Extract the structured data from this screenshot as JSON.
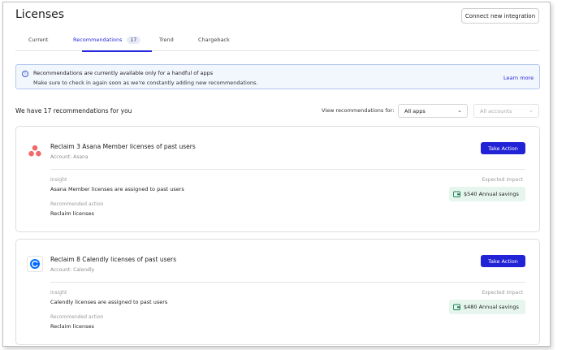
{
  "page": {
    "title": "Licenses",
    "connect_button": "Connect new integration"
  },
  "tabs": [
    {
      "label": "Current"
    },
    {
      "label": "Recommendations",
      "badge": "17",
      "active": true
    },
    {
      "label": "Trend"
    },
    {
      "label": "Chargeback"
    }
  ],
  "banner": {
    "line1": "Recommendations are currently available only for a handful of apps",
    "line2": "Make sure to check in again soon as we're constantly adding new recommendations.",
    "link": "Learn more"
  },
  "summary": {
    "text": "We have 17 recommendations for you",
    "filter_label": "View recommendations for:",
    "apps_select": "All apps",
    "accounts_select": "All accounts"
  },
  "cards": [
    {
      "title": "Reclaim 3 Asana Member licenses of past users",
      "account": "Account: Asana",
      "action": "Take Action",
      "insight_label": "Insight",
      "insight": "Asana Member licenses are assigned to past users",
      "recommended_label": "Recommended action",
      "recommended": "Reclaim licenses",
      "impact_label": "Expected impact",
      "impact": "$540 Annual savings",
      "logo_icon": "asana-logo-icon"
    },
    {
      "title": "Reclaim 8 Calendly licenses of past users",
      "account": "Account: Calendly",
      "action": "Take Action",
      "insight_label": "Insight",
      "insight": "Calendly licenses are assigned to past users",
      "recommended_label": "Recommended action",
      "recommended": "Reclaim licenses",
      "impact_label": "Expected impact",
      "impact": "$480 Annual savings",
      "logo_icon": "calendly-logo-icon"
    }
  ],
  "colors": {
    "accent": "#2222d6",
    "banner_bg": "#f2f6fd",
    "savings_bg": "#e6f6ef",
    "asana": "#f06a6a",
    "calendly": "#006bff"
  }
}
